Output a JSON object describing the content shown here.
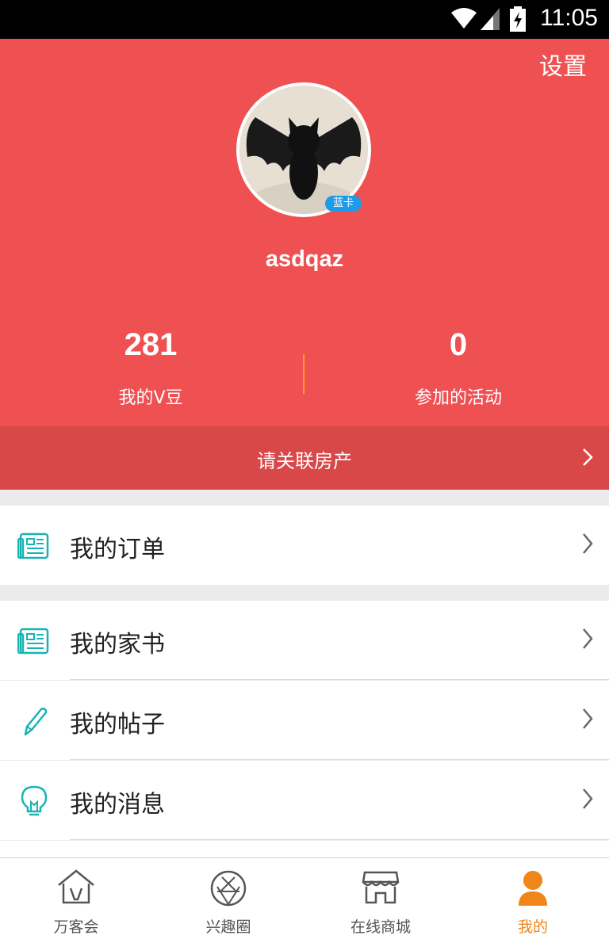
{
  "status_bar": {
    "time": "11:05"
  },
  "header": {
    "settings_label": "设置",
    "badge": "蓝卡",
    "username": "asdqaz",
    "stats": [
      {
        "value": "281",
        "label": "我的V豆"
      },
      {
        "value": "0",
        "label": "参加的活动"
      }
    ],
    "link_property": "请关联房产"
  },
  "menu": [
    {
      "label": "我的订单",
      "icon": "document-icon"
    },
    {
      "label": "我的家书",
      "icon": "document-icon"
    },
    {
      "label": "我的帖子",
      "icon": "pencil-icon"
    },
    {
      "label": "我的消息",
      "icon": "lightbulb-icon"
    }
  ],
  "tabs": [
    {
      "label": "万客会",
      "icon": "house-icon"
    },
    {
      "label": "兴趣圈",
      "icon": "aperture-icon"
    },
    {
      "label": "在线商城",
      "icon": "store-icon"
    },
    {
      "label": "我的",
      "icon": "person-icon"
    }
  ],
  "colors": {
    "header_bg": "#ef5153",
    "link_bar_bg": "#d94849",
    "accent_teal": "#1ab3b3",
    "active_tab": "#f08519",
    "badge": "#1e9be8"
  }
}
